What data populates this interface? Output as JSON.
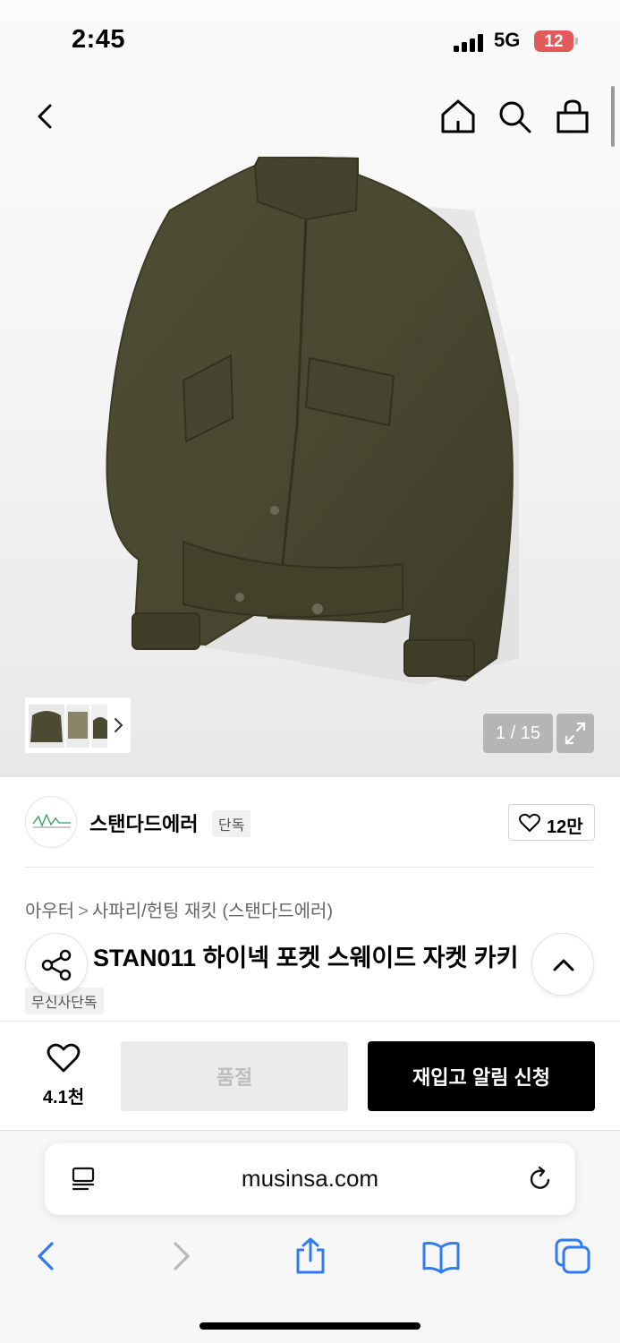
{
  "status": {
    "time": "2:45",
    "network": "5G",
    "battery": "12"
  },
  "gallery": {
    "counter": "1 / 15"
  },
  "brand": {
    "name": "스탠다드에러",
    "badge": "단독",
    "likes": "12만"
  },
  "breadcrumb": {
    "category": "아우터",
    "separator": ">",
    "sub": "사파리/헌팅 재킷 (스탠다드에러)"
  },
  "product": {
    "title": "STAN011 하이넥 포켓 스웨이드 자켓 카키",
    "tag": "무신사단독"
  },
  "buy_bar": {
    "wish_count": "4.1천",
    "soldout_label": "품절",
    "restock_label": "재입고 알림 신청"
  },
  "browser": {
    "url": "musinsa.com"
  },
  "colors": {
    "accent_black": "#000000",
    "safari_blue": "#2f7bf5",
    "jacket_khaki": "#4b4a32",
    "battery_red": "#e35a5a"
  },
  "icons": [
    "back-icon",
    "home-icon",
    "search-icon",
    "cart-icon",
    "chevron-right-icon",
    "expand-icon",
    "heart-icon",
    "share-icon",
    "chevron-up-icon",
    "reader-icon",
    "reload-icon",
    "share-sheet-icon",
    "bookmarks-icon",
    "tabs-icon"
  ]
}
